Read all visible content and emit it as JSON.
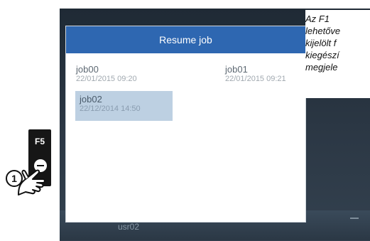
{
  "screen": {
    "dialog_title": "Resume job",
    "jobs": [
      {
        "name": "job00",
        "date": "22/01/2015 09:20",
        "selected": false
      },
      {
        "name": "job01",
        "date": "22/01/2015 09:21",
        "selected": false
      },
      {
        "name": "job02",
        "date": "22/12/2014 14:50",
        "selected": true
      }
    ],
    "user": "usr02"
  },
  "callout": {
    "key_label": "F5",
    "step_number": "1"
  },
  "note": {
    "lines": [
      "Az F1",
      "lehetőve",
      "kijelölt f",
      "kiegészí",
      "megjele"
    ]
  },
  "colors": {
    "header_blue": "#2e67b1",
    "selection": "#bdd0e2"
  }
}
